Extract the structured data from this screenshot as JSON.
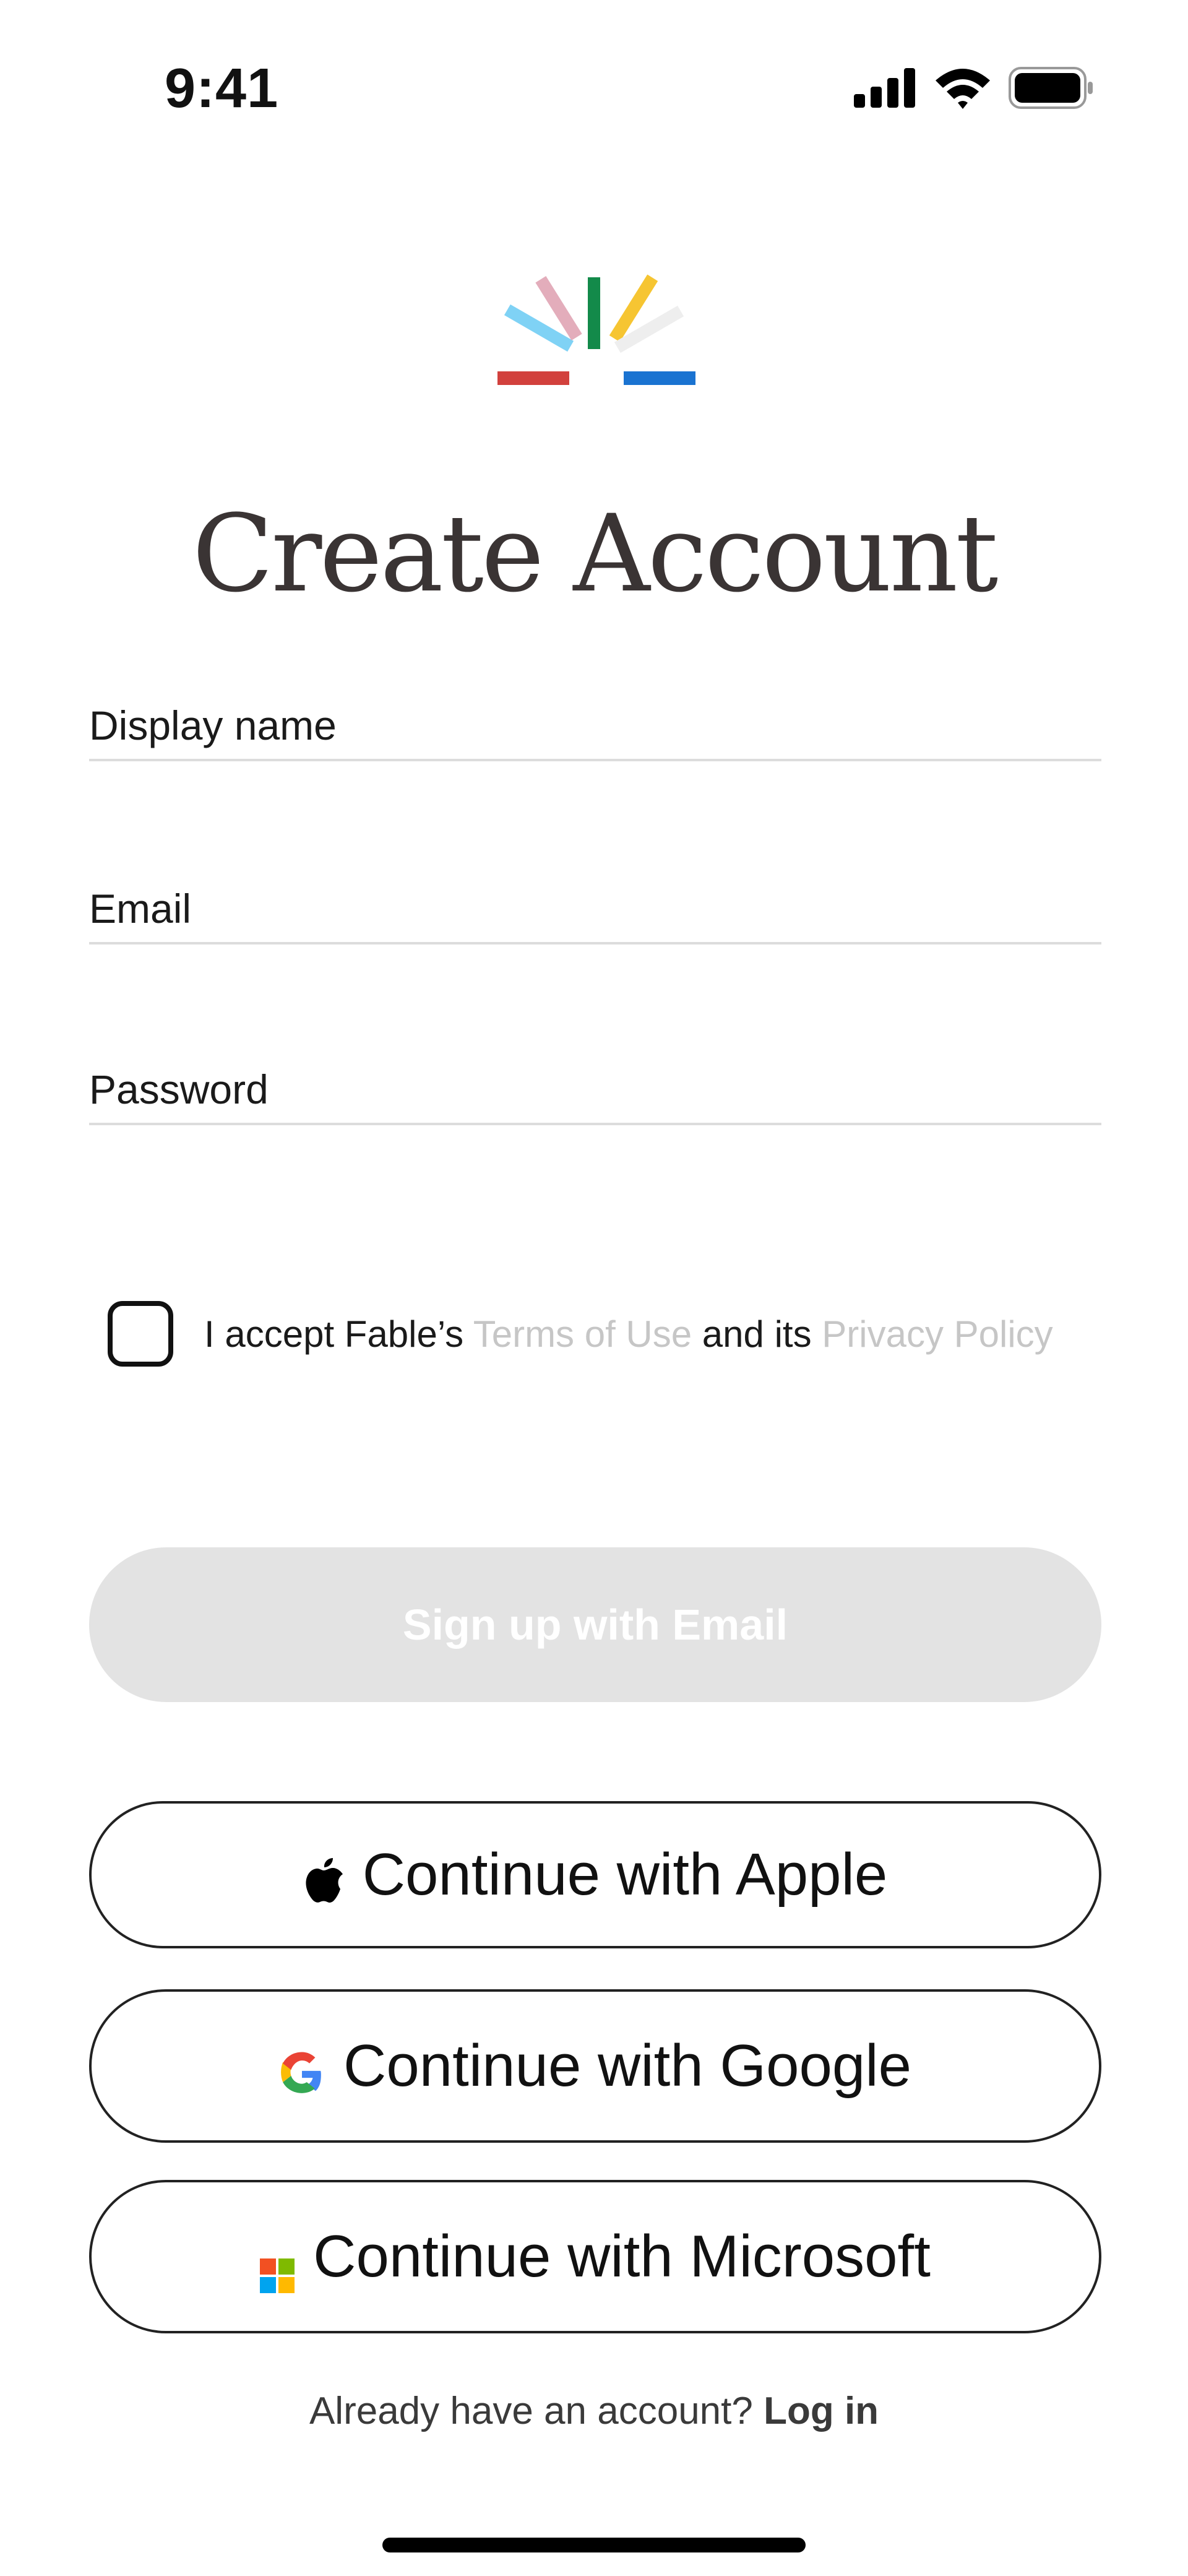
{
  "status_bar": {
    "time": "9:41"
  },
  "icons": {
    "signal": "signal-icon",
    "wifi": "wifi-icon",
    "battery": "battery-icon",
    "logo": "fable-logo-icon",
    "apple": "apple-icon",
    "google": "google-icon",
    "microsoft": "microsoft-icon"
  },
  "page": {
    "title": "Create Account"
  },
  "form": {
    "display_name_label": "Display name",
    "email_label": "Email",
    "password_label": "Password"
  },
  "terms": {
    "prefix": "I accept Fable’s ",
    "terms_link": "Terms of Use",
    "middle": " and its ",
    "privacy_link": "Privacy Policy",
    "checked": false
  },
  "buttons": {
    "email_signup": "Sign up with Email",
    "apple": "Continue with Apple",
    "google": "Continue with Google",
    "microsoft": "Continue with Microsoft"
  },
  "footer": {
    "prompt": "Already have an account? ",
    "login_link": "Log in"
  },
  "colors": {
    "title": "#3a3434",
    "disabled_button_bg": "#e3e3e3",
    "link_muted": "#c6c6c6",
    "logo_red": "#d2413d",
    "logo_light_blue": "#7fd2f5",
    "logo_pink": "#e3adbb",
    "logo_green": "#138a4a",
    "logo_yellow": "#f6c532",
    "logo_light_gray": "#eeeeee",
    "logo_blue": "#1a73d1"
  }
}
